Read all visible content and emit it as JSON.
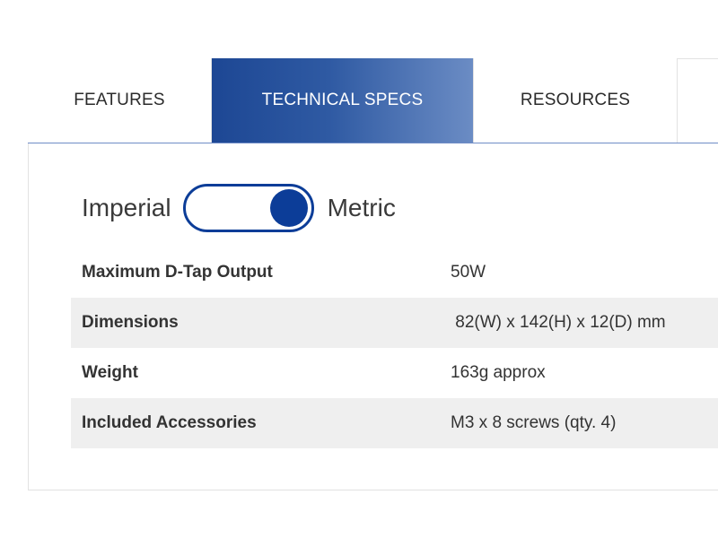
{
  "tabs": [
    {
      "label": "FEATURES"
    },
    {
      "label": "TECHNICAL SPECS"
    },
    {
      "label": "RESOURCES"
    }
  ],
  "active_tab": "TECHNICAL SPECS",
  "units": {
    "left_label": "Imperial",
    "right_label": "Metric",
    "selected": "Metric"
  },
  "specs": [
    {
      "name": "Maximum D-Tap Output",
      "value": "50W"
    },
    {
      "name": "Dimensions",
      "value": " 82(W) x 142(H) x 12(D) mm"
    },
    {
      "name": "Weight",
      "value": "163g approx"
    },
    {
      "name": "Included Accessories",
      "value": "M3 x 8 screws (qty. 4)"
    }
  ],
  "colors": {
    "accent": "#0c3d98",
    "active_tab_start": "#1d4794",
    "active_tab_end": "#6b8cc4",
    "row_shade": "#efefef"
  }
}
